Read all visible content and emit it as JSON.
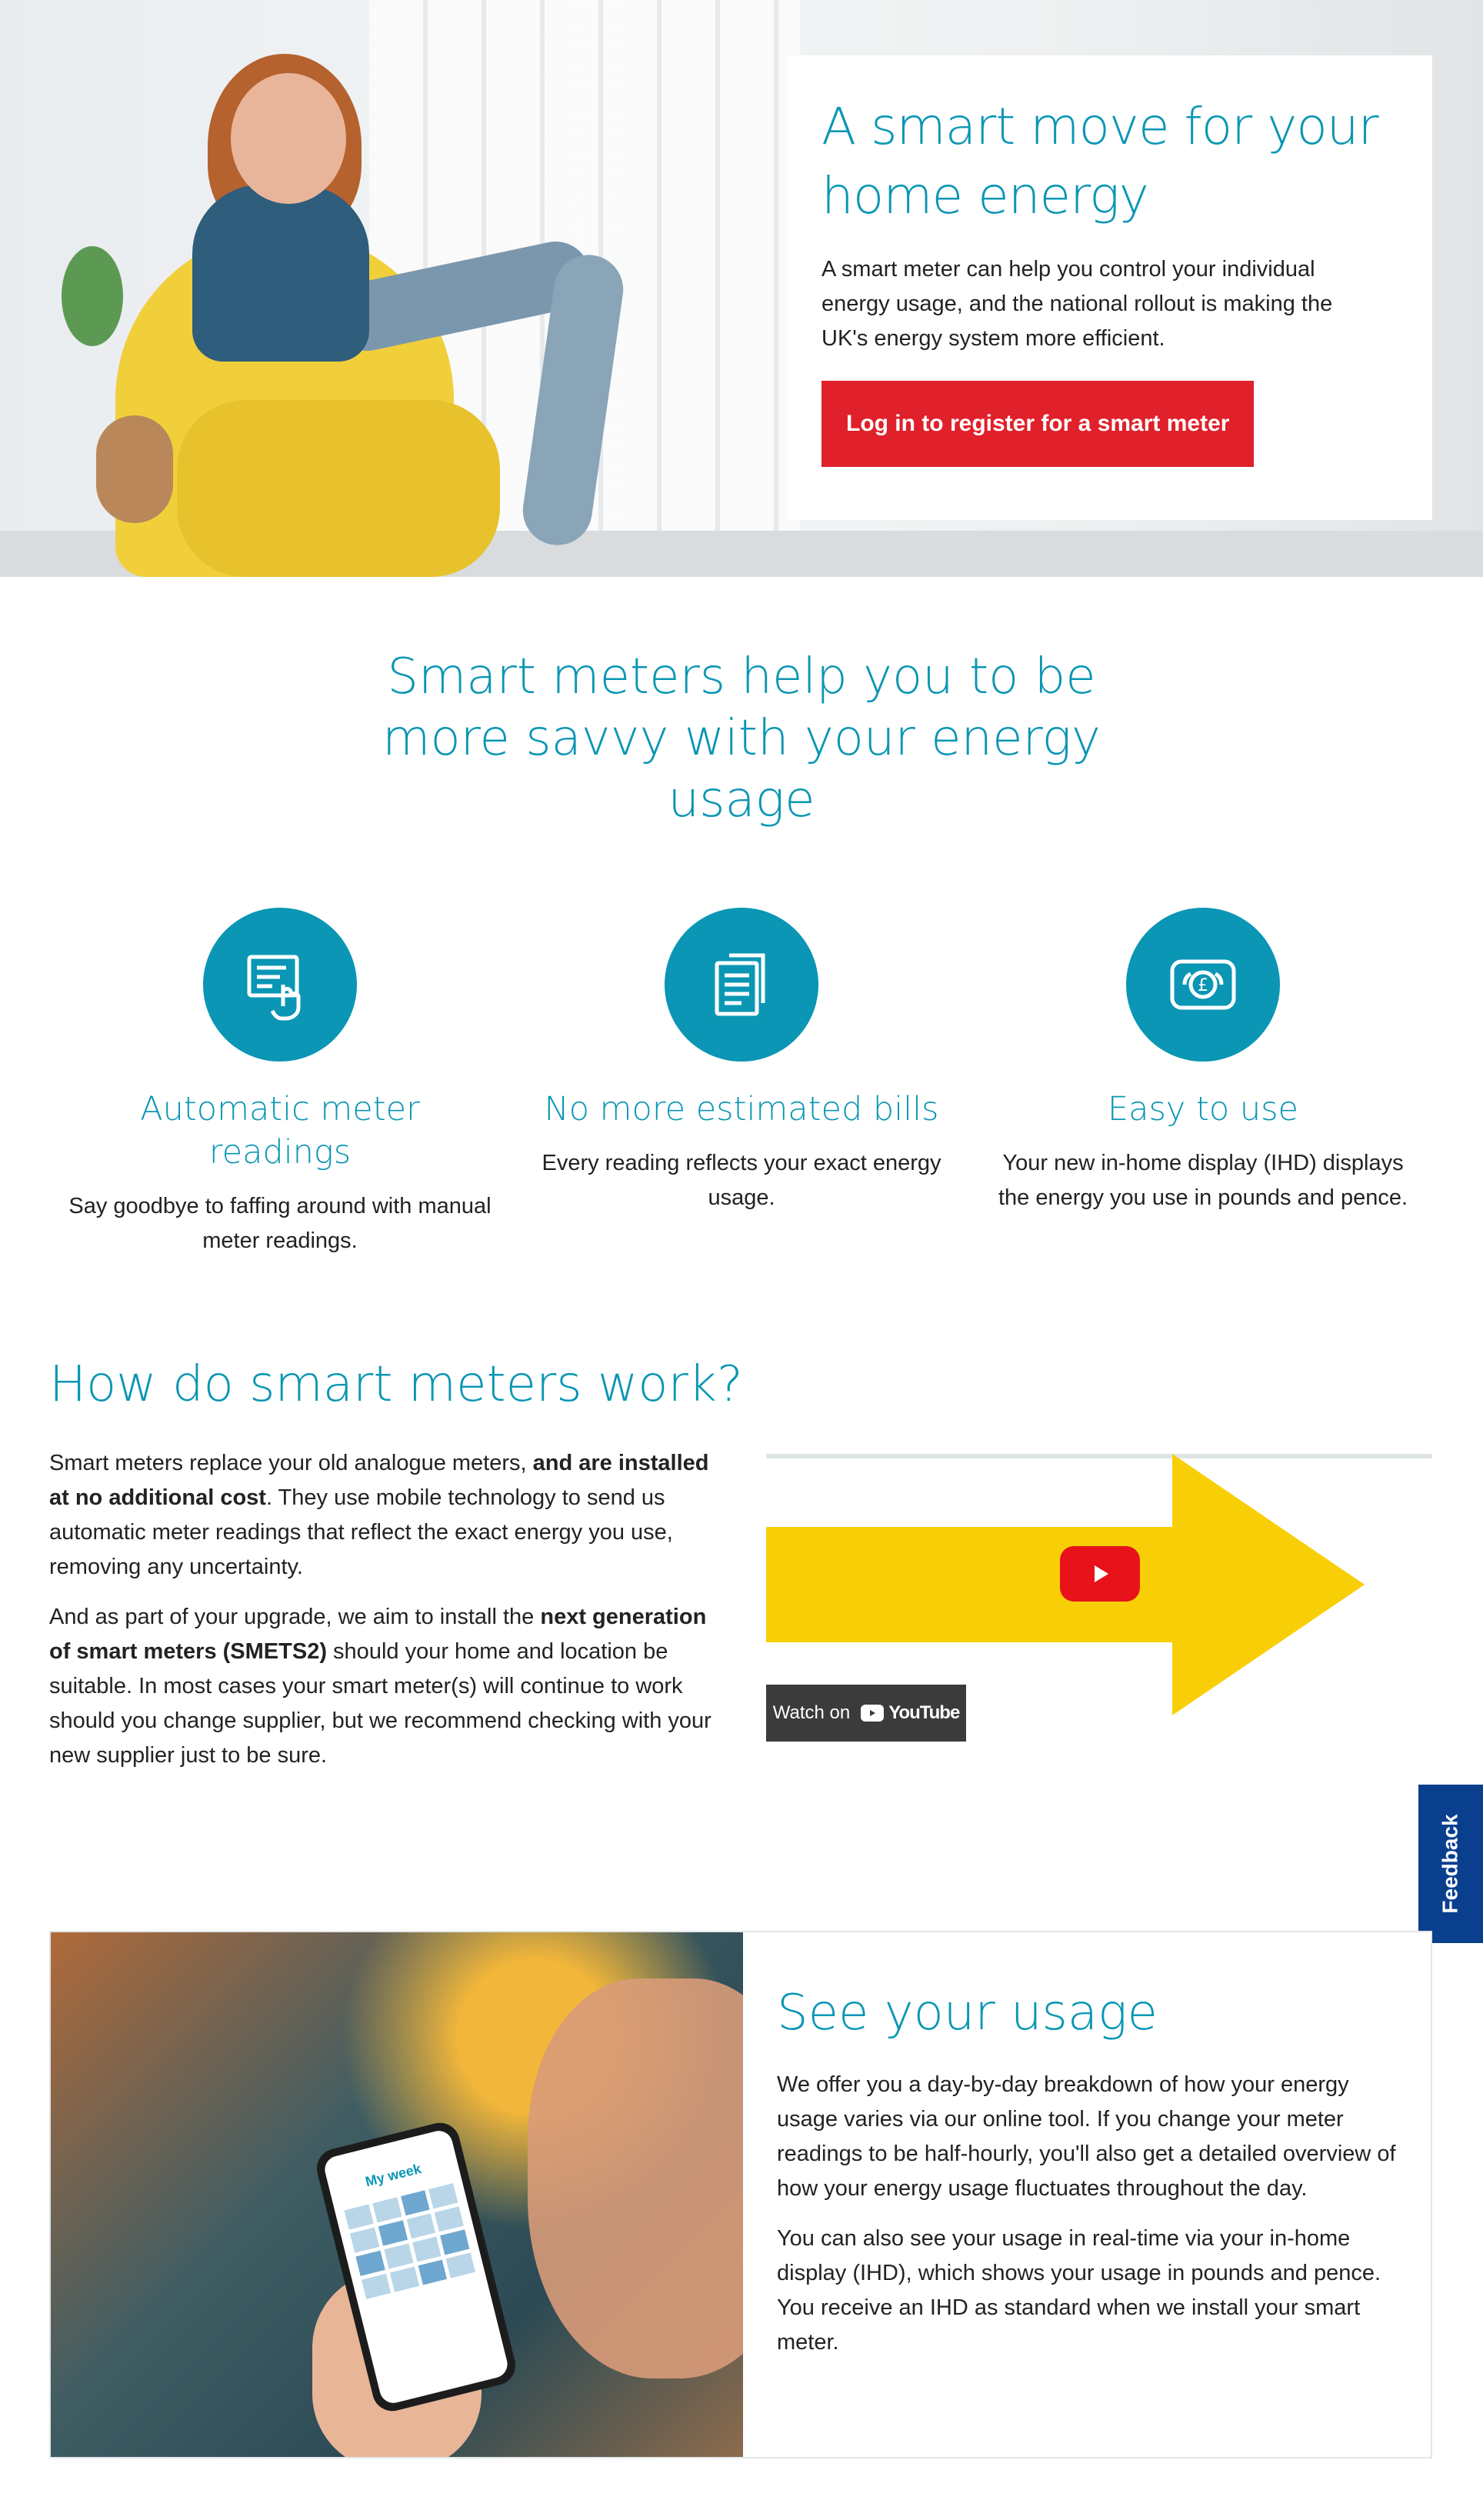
{
  "hero": {
    "title": "A smart move for your home energy",
    "text": "A smart meter can help you control your individual energy usage, and the national rollout is making the UK's energy system more efficient.",
    "button": "Log in to register for a smart meter"
  },
  "benefits": {
    "title": "Smart meters help you to be more savvy with your energy usage",
    "items": [
      {
        "icon": "touch-readings-icon",
        "title": "Automatic meter readings",
        "text": "Say goodbye to faffing around with manual meter readings."
      },
      {
        "icon": "documents-icon",
        "title": "No more estimated bills",
        "text": "Every reading reflects your exact energy usage."
      },
      {
        "icon": "pound-display-icon",
        "title": "Easy to use",
        "text": "Your new in-home display (IHD) displays the energy you use in pounds and pence."
      }
    ]
  },
  "how": {
    "title": "How do smart meters work?",
    "p1_a": "Smart meters replace your old analogue meters, ",
    "p1_b": "and are installed at no additional cost",
    "p1_c": ". They use mobile technology to send us automatic meter readings that reflect the exact energy you use, removing any uncertainty.",
    "p2_a": "And as part of your upgrade, we aim to install the ",
    "p2_b": "next generation of smart meters (SMETS2)",
    "p2_c": " should your home and location be suitable. In most cases your smart meter(s) will continue to work should you change supplier, but we recommend checking with your new supplier just to be sure.",
    "video": {
      "watch_label": "Watch on",
      "brand": "YouTube"
    }
  },
  "feedback": {
    "label": "Feedback"
  },
  "usage": {
    "title": "See your usage",
    "p1": "We offer you a day-by-day breakdown of how your energy usage varies via our online tool. If you change your meter readings to be half-hourly, you'll also get a detailed overview of how your energy usage fluctuates throughout the day.",
    "p2": "You can also see your usage in real-time via your in-home display (IHD), which shows your usage in pounds and pence. You receive an IHD as standard when we install your smart meter.",
    "phone_title": "My week"
  },
  "colors": {
    "accent": "#0a96b4",
    "cta": "#e0202a",
    "feedback": "#0a3f8e",
    "video_arrow": "#f8cf07"
  }
}
